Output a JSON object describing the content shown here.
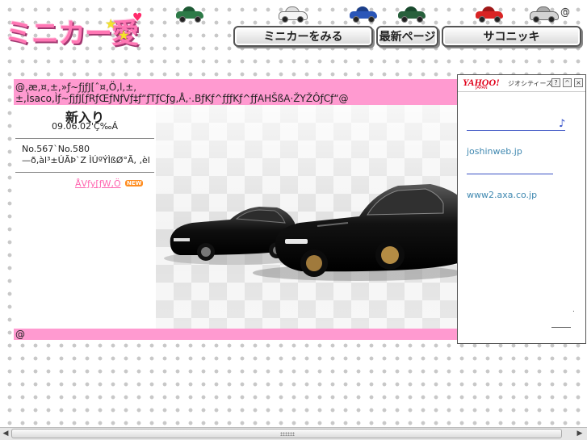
{
  "logo": {
    "text": "ミニカー愛"
  },
  "nav": {
    "buttons": [
      "ミニカーをみる",
      "最新ページ",
      "サコニッキ"
    ],
    "corner_mark": "@"
  },
  "top_garbled": "@,æ,¤,±,»ƒ~ƒjƒJ[ˆ¤,Ö,l,±,±,Ìsaco,Ìƒ~ƒjƒJ[ƒRƒŒƒNƒVƒ‡ƒ“ƒTƒCƒg,Å,·.BƒKƒ^ƒƒƒKƒ^ƒƒAHŠßA·ŽYŽÔƒCƒ“@",
  "new_arrivals": {
    "title": "新入り",
    "date": "09.06.02'Ç‰Á",
    "line1": "No.567`No.580",
    "line2": "—ð‚àl³±ÚÃÞ`Z ÌÚºÝÌßØ°Ã, ‚èl",
    "link_text": "ÅVƒy[ƒW,Ö",
    "badge": "NEW"
  },
  "bottom_bar": {
    "text": "@"
  },
  "geocities": {
    "brand": "YAHOO!",
    "brand_sub": "JAPAN",
    "label": "ジオシティーズ",
    "buttons": [
      "?",
      "^",
      "×"
    ],
    "note_symbol": "♪",
    "domains": [
      "joshinweb.jp",
      "www2.axa.co.jp"
    ],
    "dot": "."
  },
  "colors": {
    "pink_bar": "#ff9ad0",
    "logo_pink": "#ff77b4",
    "link_pink": "#ff66b0",
    "yahoo_red": "#e0001a",
    "ad_link_blue": "#3f88b0"
  },
  "icons": [
    "car-green-icon",
    "car-white-icon",
    "car-blue-icon",
    "car-darkgreen-icon",
    "car-red-icon",
    "car-silver-icon"
  ]
}
